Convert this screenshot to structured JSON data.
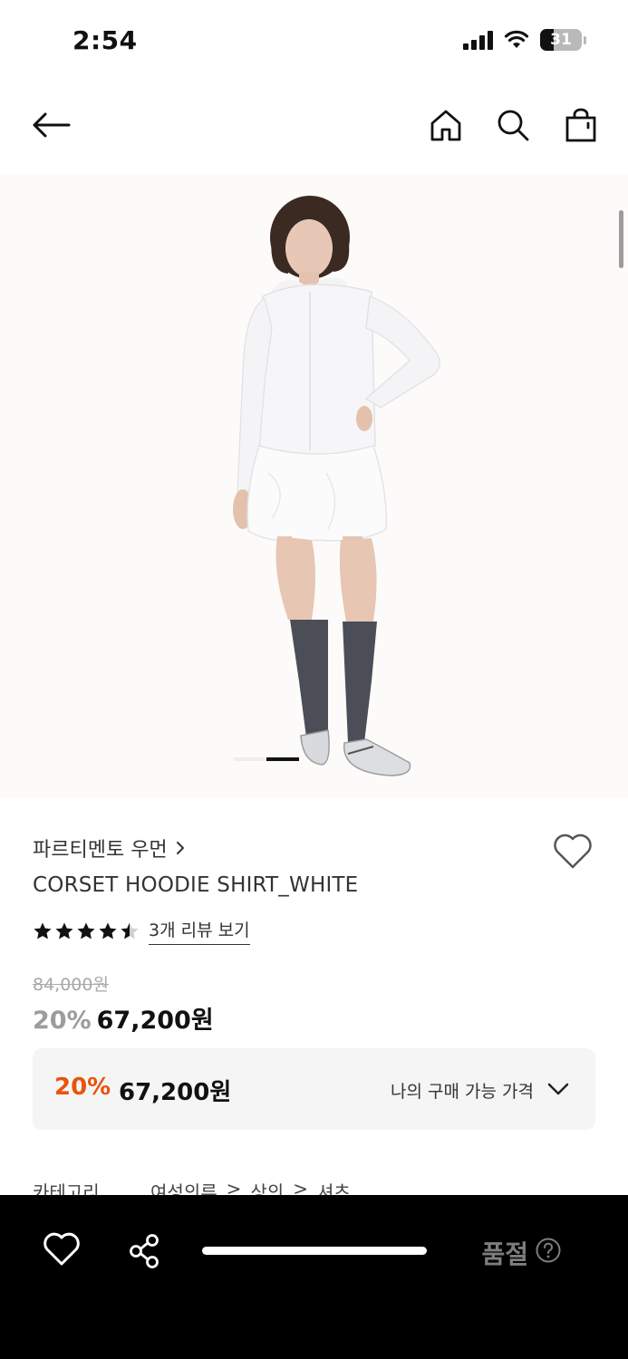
{
  "status_bar": {
    "time": "2:54",
    "battery_level": "31"
  },
  "nav": {
    "back_icon": "arrow-left-icon",
    "home_icon": "home-icon",
    "search_icon": "search-icon",
    "bag_icon": "shopping-bag-icon"
  },
  "hero": {
    "image_count_indicator": 2,
    "active_index": 1
  },
  "product": {
    "brand": "파르티멘토 우먼",
    "name": "CORSET HOODIE SHIRT_WHITE",
    "rating": 4.5,
    "review_link": "3개 리뷰 보기",
    "original_price": "84,000원",
    "discount_percent": "20%",
    "sale_price": "67,200원"
  },
  "my_price": {
    "discount_percent": "20%",
    "price": "67,200원",
    "label": "나의 구매 가능 가격"
  },
  "category": {
    "label": "카테고리",
    "path": [
      "여성의류",
      ">",
      "상의",
      ">",
      "셔츠"
    ]
  },
  "bottom_bar": {
    "wishlist_icon": "heart-icon",
    "share_icon": "share-icon",
    "sold_out_label": "품절",
    "help_icon": "question-circle-icon"
  },
  "colors": {
    "accent_orange": "#e8540c",
    "bottom_bar_bg": "#000000",
    "muted_gray": "#9c9c9c"
  }
}
